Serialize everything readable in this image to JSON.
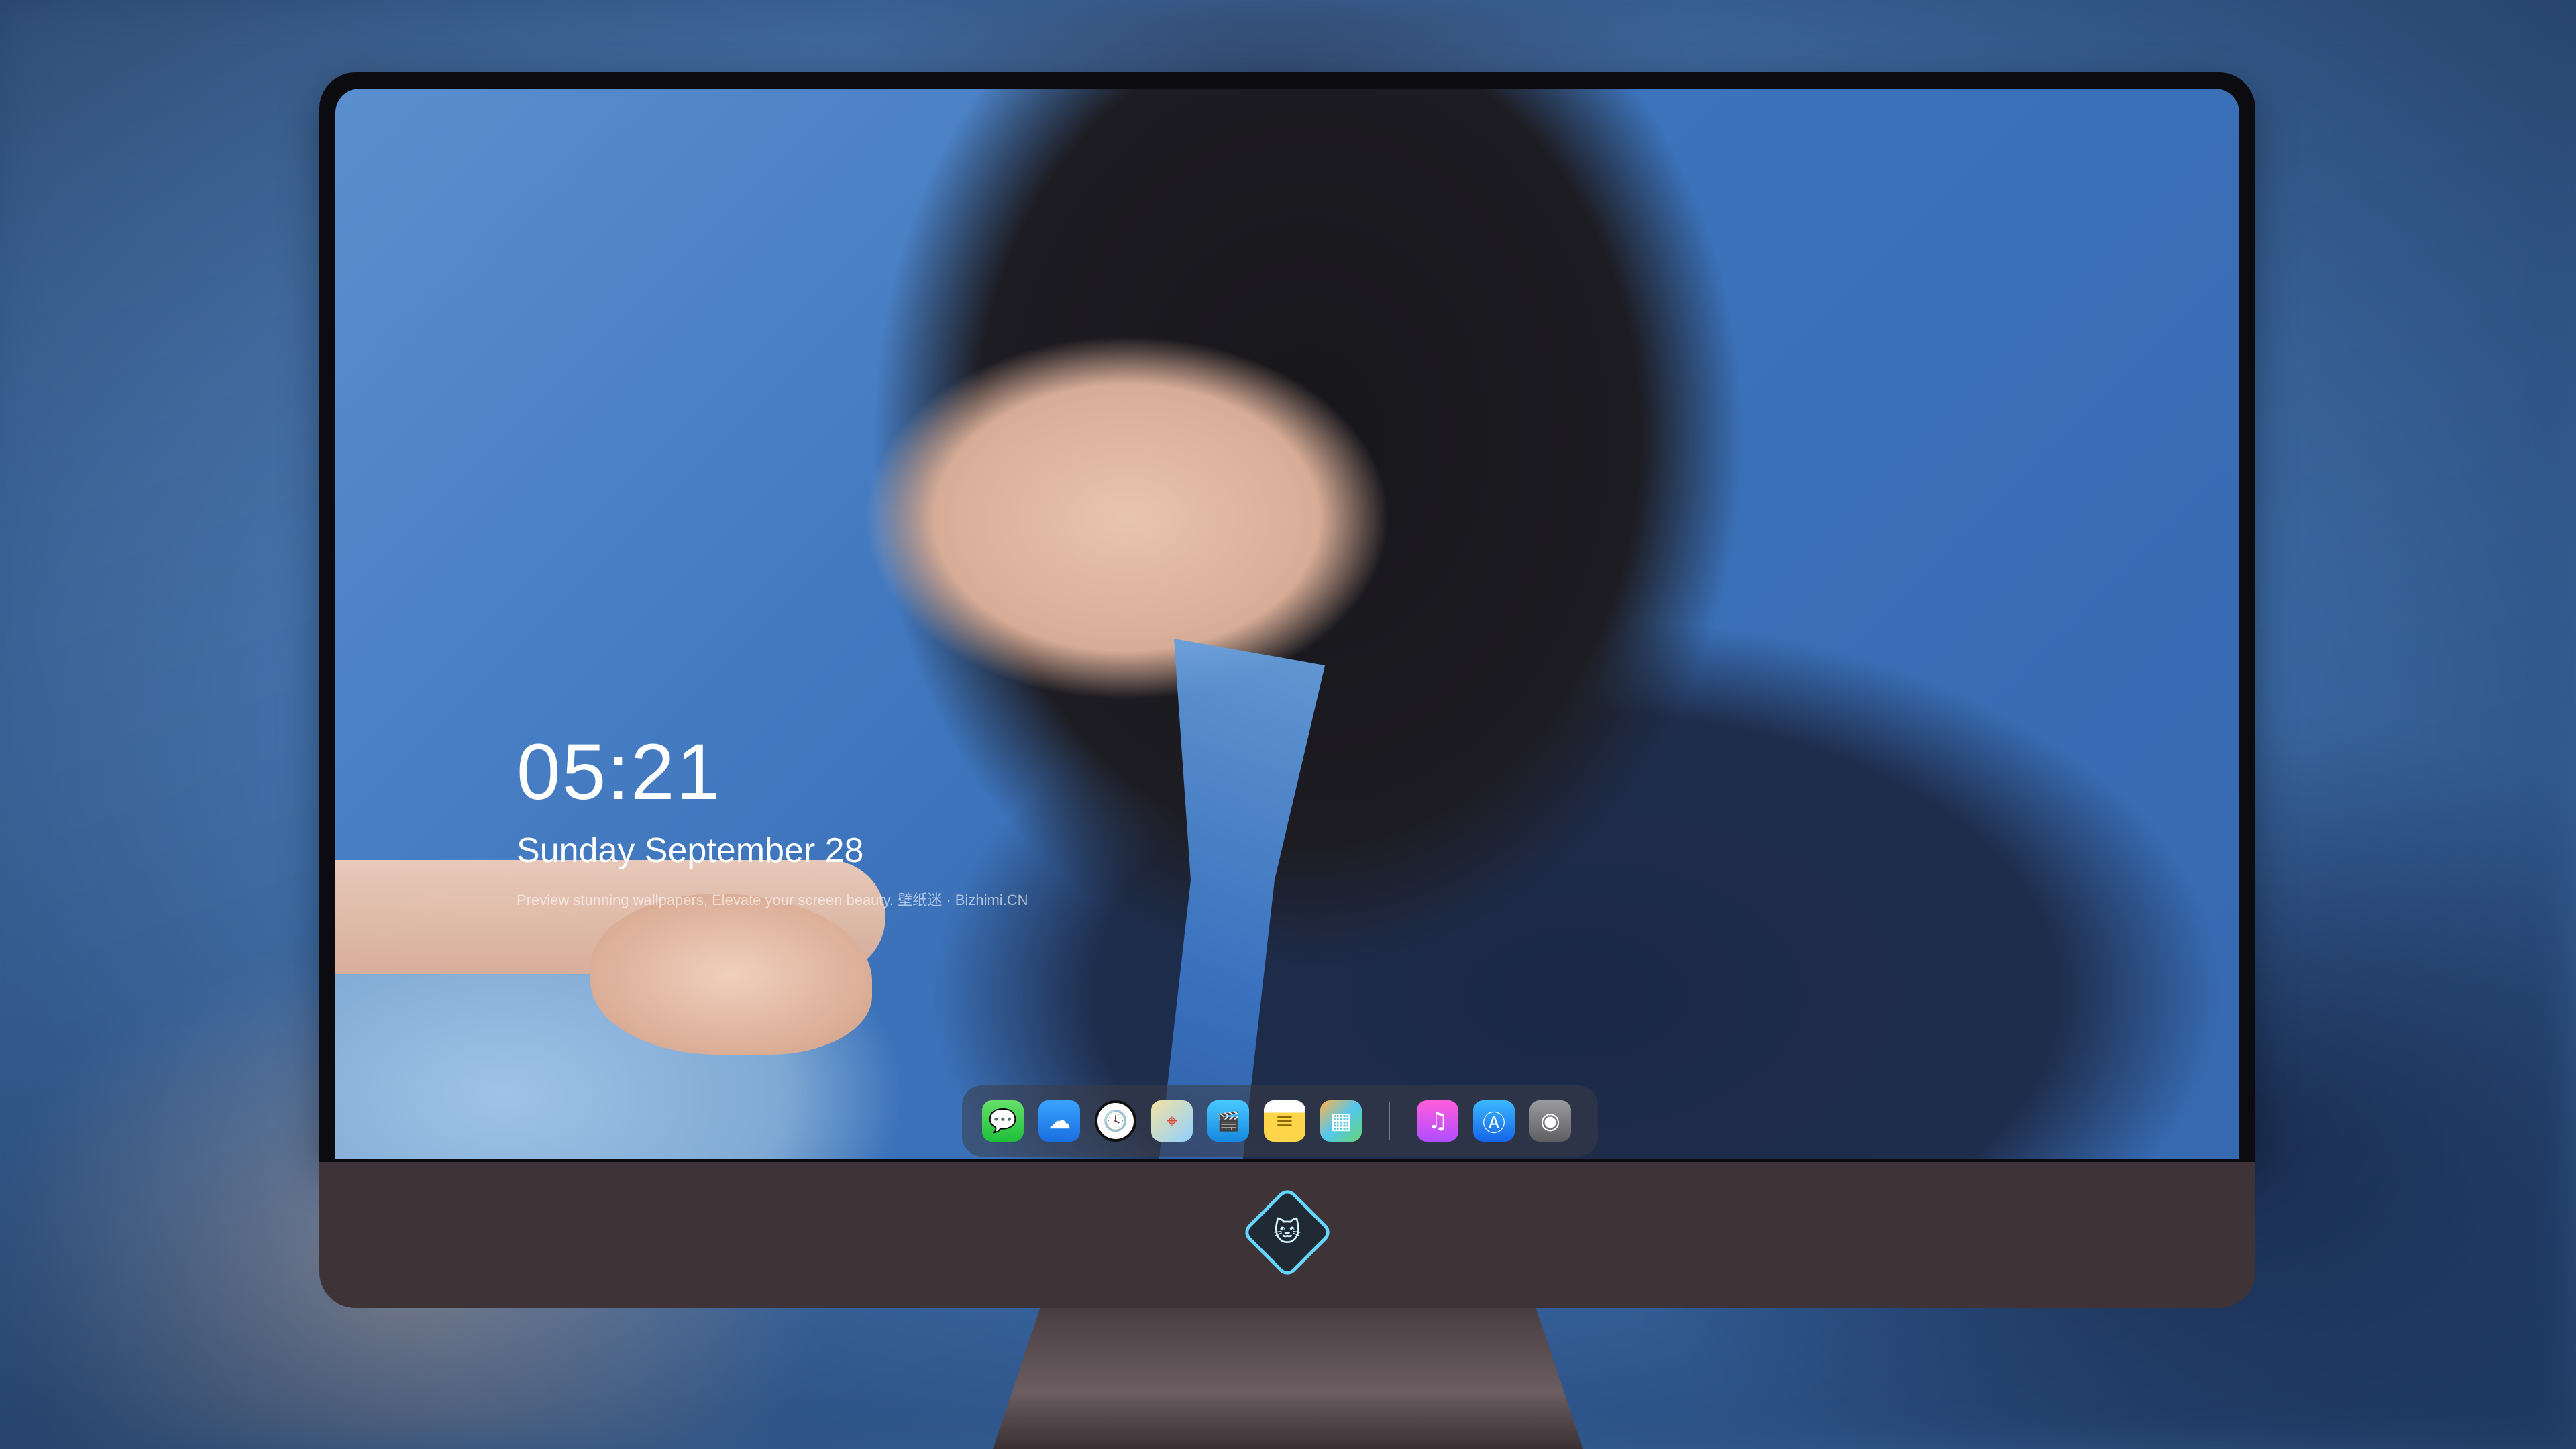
{
  "clock": {
    "time": "05:21",
    "date": "Sunday September  28",
    "tagline": "Preview stunning wallpapers, Elevate your screen beauty. 壁纸迷 · Bizhimi.CN"
  },
  "dock": {
    "apps": [
      {
        "name": "messages-icon",
        "glyph": "💬"
      },
      {
        "name": "weather-icon",
        "glyph": "☁"
      },
      {
        "name": "clock-icon",
        "glyph": "🕓"
      },
      {
        "name": "maps-icon",
        "glyph": "⌖"
      },
      {
        "name": "clips-icon",
        "glyph": "🎬"
      },
      {
        "name": "notes-icon",
        "glyph": "≡"
      },
      {
        "name": "photos-icon",
        "glyph": "▦"
      },
      {
        "name": "music-icon",
        "glyph": "♫"
      },
      {
        "name": "app-store-icon",
        "glyph": "Ⓐ"
      },
      {
        "name": "camera-icon",
        "glyph": "◉"
      }
    ]
  },
  "brand": {
    "logo": "cat-mascot-logo",
    "glyph": "🐱"
  }
}
